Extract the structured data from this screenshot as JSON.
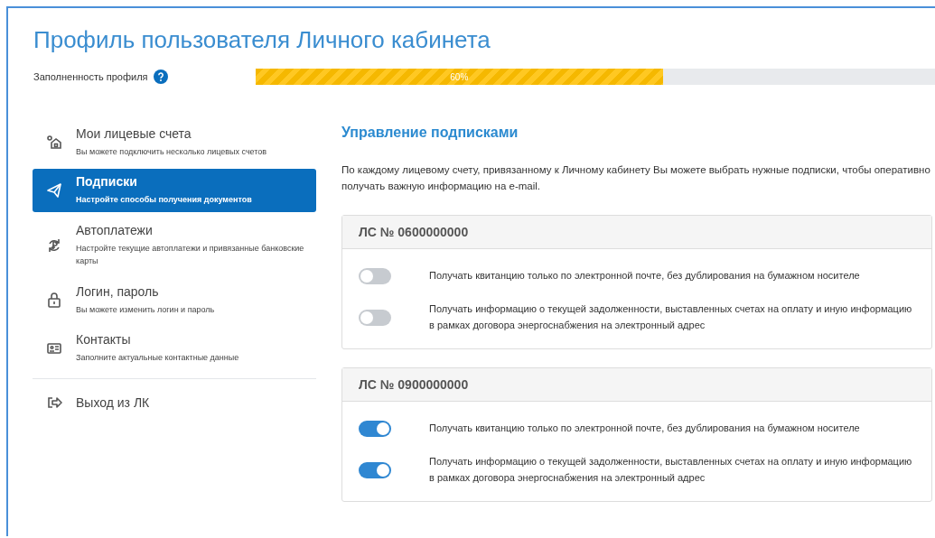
{
  "title": "Профиль пользователя Личного кабинета",
  "profile_progress": {
    "label": "Заполненность профиля",
    "level": 0.6,
    "reading": "60%"
  },
  "sidebar": {
    "items": [
      {
        "kind": "link",
        "title": "Мои лицевые счета",
        "subtitle": "Вы можете подключить несколько лицевых счетов",
        "selected": false
      },
      {
        "kind": "link",
        "title": "Подписки",
        "subtitle": "Настройте способы получения документов",
        "selected": true
      },
      {
        "kind": "link",
        "title": "Автоплатежи",
        "subtitle": "Настройте текущие автоплатежи и привязанные банковские карты",
        "selected": false
      },
      {
        "kind": "link",
        "title": "Логин, пароль",
        "subtitle": "Вы можете изменить логин и пароль",
        "selected": false
      },
      {
        "kind": "link",
        "title": "Контакты",
        "subtitle": "Заполните актуальные контактные данные",
        "selected": false
      },
      {
        "kind": "logout",
        "title": "Выход из ЛК"
      }
    ]
  },
  "main": {
    "heading": "Управление подписками",
    "intro": "По каждому лицевому счету, привязанному к Личному кабинету Вы можете выбрать нужные подписки, чтобы оперативно получать важную информацию на e-mail.",
    "accounts": [
      {
        "title": "ЛС № 0600000000",
        "options": [
          {
            "label": "Получать квитанцию только по электронной почте, без дублирования на бумажном носителе",
            "on": false
          },
          {
            "label": "Получать информацию о текущей задолженности, выставленных счетах на оплату и иную информацию в рамках договора энергоснабжения на электронный адрес",
            "on": false
          }
        ]
      },
      {
        "title": "ЛС № 0900000000",
        "options": [
          {
            "label": "Получать квитанцию только по электронной почте, без дублирования на бумажном носителе",
            "on": true
          },
          {
            "label": "Получать информацию о текущей задолженности, выставленных счетах на оплату и иную информацию в рамках договора энергоснабжения на электронный адрес",
            "on": true
          }
        ]
      }
    ]
  }
}
